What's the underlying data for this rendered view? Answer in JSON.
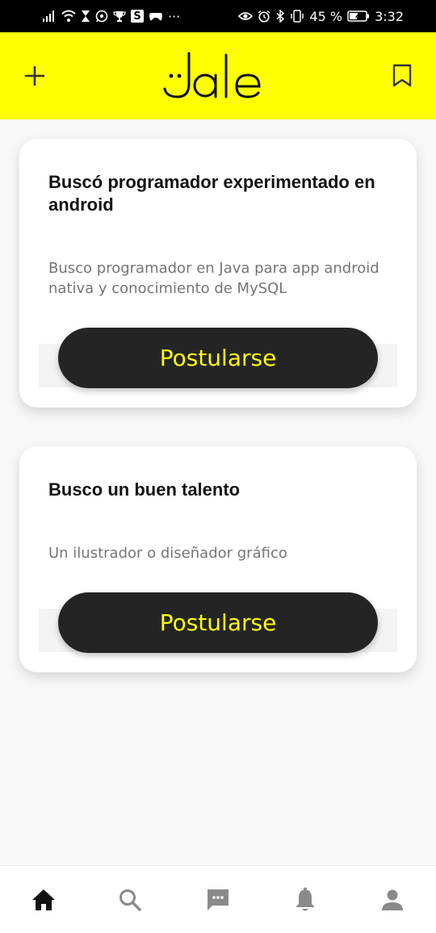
{
  "status_bar": {
    "battery_percent": "45 %",
    "time": "3:32",
    "more_indicator": "···",
    "s_badge": "S",
    "left_icons": [
      "signal-icon",
      "wifi-icon",
      "hourglass-icon",
      "whatsapp-icon",
      "trophy-icon",
      "s-app-icon",
      "game-icon",
      "more-dots-icon"
    ],
    "right_icons": [
      "eye-icon",
      "alarm-icon",
      "bluetooth-icon",
      "vibrate-icon",
      "battery-icon"
    ]
  },
  "app_bar": {
    "background_color": "#ffff00",
    "logo_text": "Jale",
    "left_icon": "plus-icon",
    "right_icon": "bookmark-icon"
  },
  "posts": [
    {
      "title": "Buscó programador experimentado en android",
      "description": "Busco programador en Java para app android nativa y conocimiento de MySQL",
      "button_label": "Postularse"
    },
    {
      "title": "Busco un buen talento",
      "description": "Un ilustrador o diseñador gráfico",
      "button_label": "Postularse"
    }
  ],
  "bottom_nav": {
    "items": [
      {
        "icon": "home-icon",
        "active": true
      },
      {
        "icon": "search-icon",
        "active": false
      },
      {
        "icon": "chat-icon",
        "active": false
      },
      {
        "icon": "bell-icon",
        "active": false
      },
      {
        "icon": "person-icon",
        "active": false
      }
    ],
    "active_color": "#111111",
    "inactive_color": "#8a8a8a"
  },
  "colors": {
    "accent_yellow": "#ffff00",
    "button_dark": "#242424",
    "title_text": "#121212",
    "description_text": "#757575"
  }
}
